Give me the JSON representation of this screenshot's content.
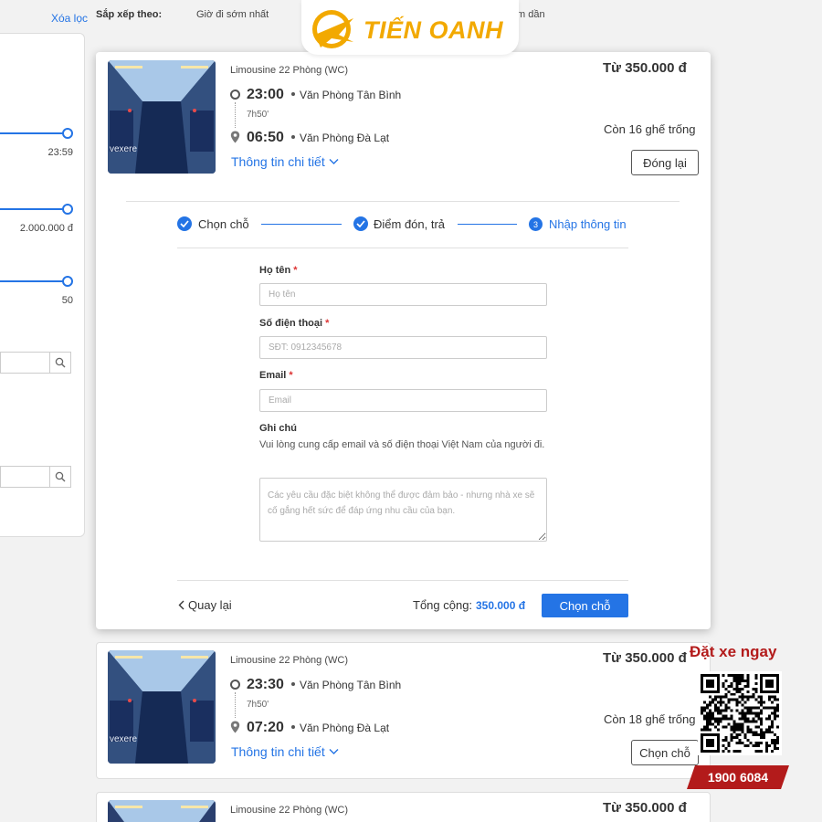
{
  "filters": {
    "clear_label": "Xóa lọc",
    "time_max": "23:59",
    "price_max": "2.000.000 đ",
    "seats_max": "50"
  },
  "sort": {
    "label": "Sắp xếp theo:",
    "option_earliest": "Giờ đi sớm nhất",
    "option_partial": "m dần"
  },
  "brand": {
    "name": "TIẾN OANH",
    "color": "#f2a900"
  },
  "trips": [
    {
      "bus_type": "Limousine 22 Phòng (WC)",
      "price": "Từ 350.000 đ",
      "depart_time": "23:00",
      "depart_place": "Văn Phòng Tân Bình",
      "duration": "7h50'",
      "arrive_time": "06:50",
      "arrive_place": "Văn Phòng Đà Lạt",
      "seats": "Còn 16 ghế trống",
      "detail_label": "Thông tin chi tiết",
      "action_label": "Đóng lại",
      "img_watermark": "vexere"
    },
    {
      "bus_type": "Limousine 22 Phòng (WC)",
      "price": "Từ 350.000 đ",
      "depart_time": "23:30",
      "depart_place": "Văn Phòng Tân Bình",
      "duration": "7h50'",
      "arrive_time": "07:20",
      "arrive_place": "Văn Phòng Đà Lạt",
      "seats": "Còn 18 ghế trống",
      "detail_label": "Thông tin chi tiết",
      "action_label": "Chọn chỗ",
      "img_watermark": "vexere"
    },
    {
      "bus_type": "Limousine 22 Phòng (WC)",
      "price": "Từ 350.000 đ"
    }
  ],
  "steps": [
    {
      "label": "Chọn chỗ",
      "state": "done"
    },
    {
      "label": "Điểm đón, trả",
      "state": "done"
    },
    {
      "number": "3",
      "label": "Nhập thông tin",
      "state": "active"
    }
  ],
  "form": {
    "name_label": "Họ tên",
    "name_placeholder": "Họ tên",
    "phone_label": "Số điện thoại",
    "phone_placeholder": "SĐT: 0912345678",
    "email_label": "Email",
    "email_placeholder": "Email",
    "note_label": "Ghi chú",
    "note_hint": "Vui lòng cung cấp email và số điện thoại Việt Nam của người đi.",
    "note_placeholder": "Các yêu cầu đặc biệt không thể được đảm bảo - nhưng nhà xe sẽ cố gắng hết sức để đáp ứng nhu cầu của bạn.",
    "required_mark": "*"
  },
  "footer": {
    "back_label": "Quay lại",
    "total_label": "Tổng cộng:",
    "total_value": "350.000 đ",
    "confirm_label": "Chọn chỗ"
  },
  "promo": {
    "title": "Đặt xe ngay",
    "hotline": "1900 6084"
  },
  "colors": {
    "accent": "#2474e5",
    "promo": "#b31b1b"
  }
}
